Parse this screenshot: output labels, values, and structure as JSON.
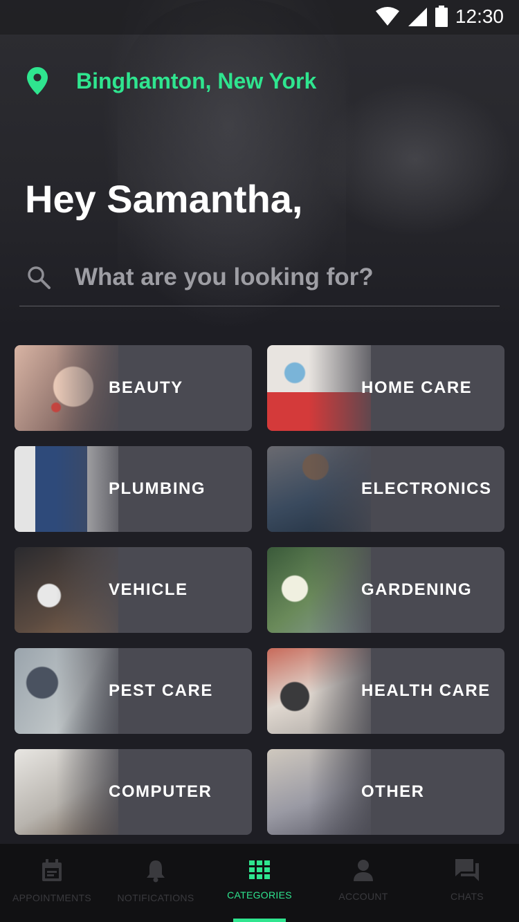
{
  "status_bar": {
    "time": "12:30",
    "icons": [
      "wifi-icon",
      "signal-icon",
      "battery-icon"
    ]
  },
  "location": {
    "icon": "location-pin-icon",
    "text": "Binghamton, New York"
  },
  "greeting": "Hey Samantha,",
  "search": {
    "icon": "search-icon",
    "placeholder": "What are you looking for?"
  },
  "categories": [
    {
      "label": "BEAUTY"
    },
    {
      "label": "HOME CARE"
    },
    {
      "label": "PLUMBING"
    },
    {
      "label": "ELECTRONICS"
    },
    {
      "label": "VEHICLE"
    },
    {
      "label": "GARDENING"
    },
    {
      "label": "PEST CARE"
    },
    {
      "label": "HEALTH CARE"
    },
    {
      "label": "COMPUTER"
    },
    {
      "label": "OTHER"
    }
  ],
  "bottom_nav": {
    "active": "CATEGORIES",
    "items": [
      {
        "label": "APPOINTMENTS",
        "icon": "calendar-icon"
      },
      {
        "label": "NOTIFICATIONS",
        "icon": "bell-icon"
      },
      {
        "label": "CATEGORIES",
        "icon": "grid-icon"
      },
      {
        "label": "ACCOUNT",
        "icon": "person-icon"
      },
      {
        "label": "CHATS",
        "icon": "chat-icon"
      }
    ]
  },
  "colors": {
    "accent": "#2fe58f",
    "background": "#1e1e24",
    "card": "#4a4a52",
    "inactive_nav": "#3a3a3e"
  }
}
